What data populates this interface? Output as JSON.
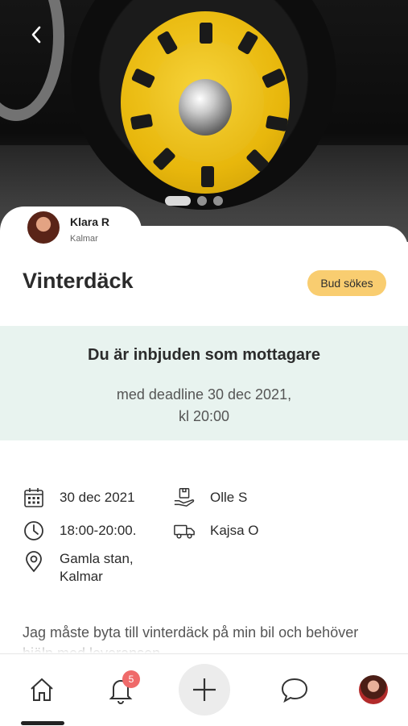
{
  "hero": {
    "image_alt": "yellow-wheel-photo",
    "active_slide": 1,
    "slide_count": 3
  },
  "owner": {
    "name": "Klara R",
    "city": "Kalmar"
  },
  "listing": {
    "title": "Vinterdäck",
    "status_badge": "Bud sökes"
  },
  "invite": {
    "title": "Du är inbjuden som mottagare",
    "line1": "med deadline 30 dec 2021,",
    "line2": "kl 20:00"
  },
  "details": {
    "date": "30 dec 2021",
    "time": "18:00-20:00.",
    "location_line1": "Gamla stan,",
    "location_line2": "Kalmar",
    "sender": "Olle S",
    "courier": "Kajsa O"
  },
  "description": "Jag måste byta till vinterdäck på min bil och behöver hjälp med leveransen.",
  "nav": {
    "notification_count": "5"
  },
  "colors": {
    "badge": "#f9cd70",
    "invite_bg": "#e8f3ef",
    "notif": "#ef6a6a"
  }
}
